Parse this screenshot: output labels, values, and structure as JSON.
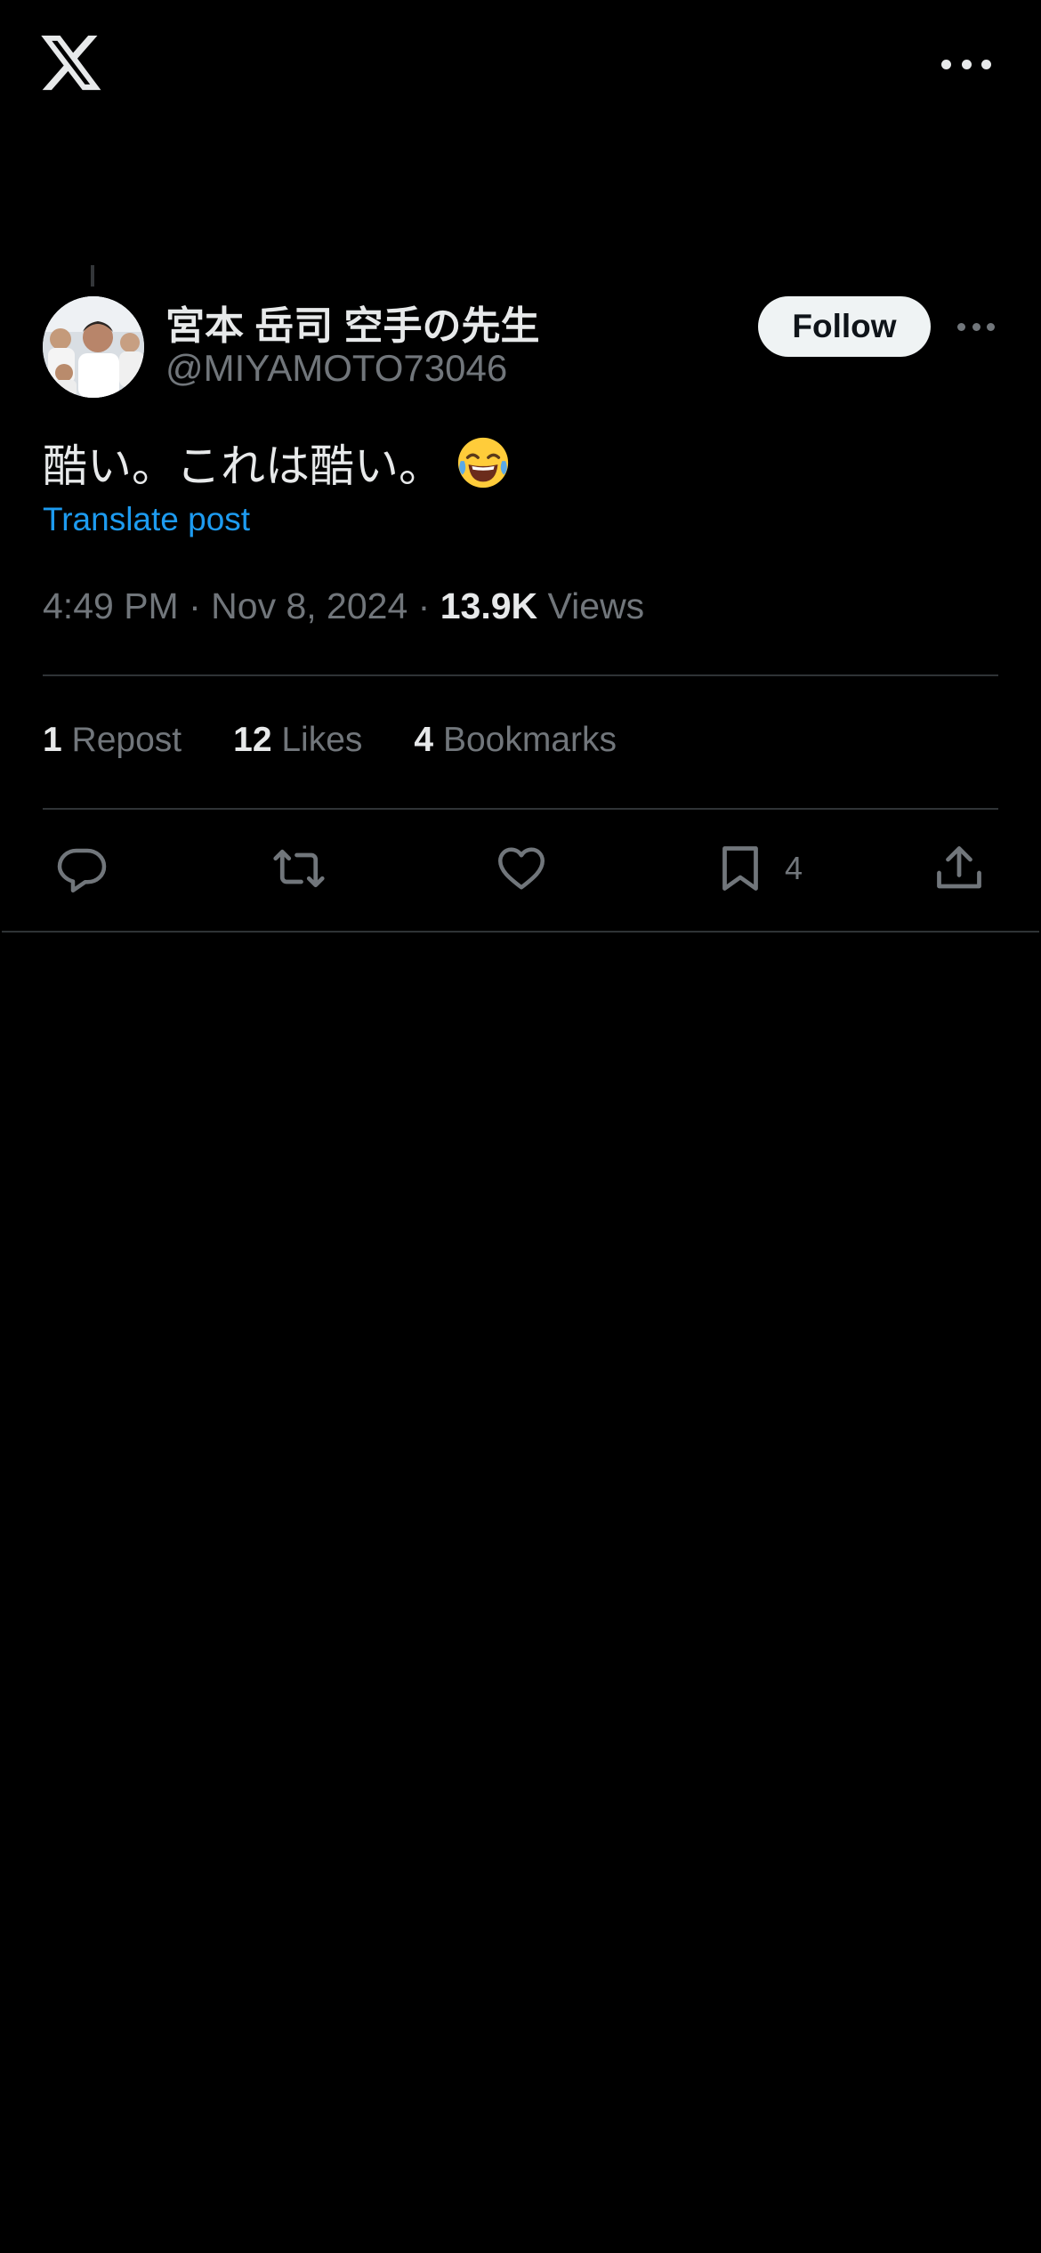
{
  "app": {
    "logo_icon": "x-logo-icon",
    "more_icon": "more-horizontal-icon"
  },
  "post": {
    "author": {
      "display_name": "宮本 岳司 空手の先生",
      "handle": "@MIYAMOTO73046"
    },
    "follow_label": "Follow",
    "text": "酷い。これは酷い。",
    "emoji": "😂",
    "translate_label": "Translate post",
    "time": "4:49 PM",
    "date": "Nov 8, 2024",
    "views_count": "13.9K",
    "views_label": "Views"
  },
  "stats": {
    "reposts": {
      "count": "1",
      "label": "Repost"
    },
    "likes": {
      "count": "12",
      "label": "Likes"
    },
    "bookmarks": {
      "count": "4",
      "label": "Bookmarks"
    }
  },
  "actions": {
    "bookmark_count": "4"
  },
  "colors": {
    "background": "#000000",
    "text": "#e7e9ea",
    "secondary_text": "#71767b",
    "link": "#1d9bf0",
    "divider": "#2f3336",
    "follow_button_bg": "#eff3f4"
  }
}
